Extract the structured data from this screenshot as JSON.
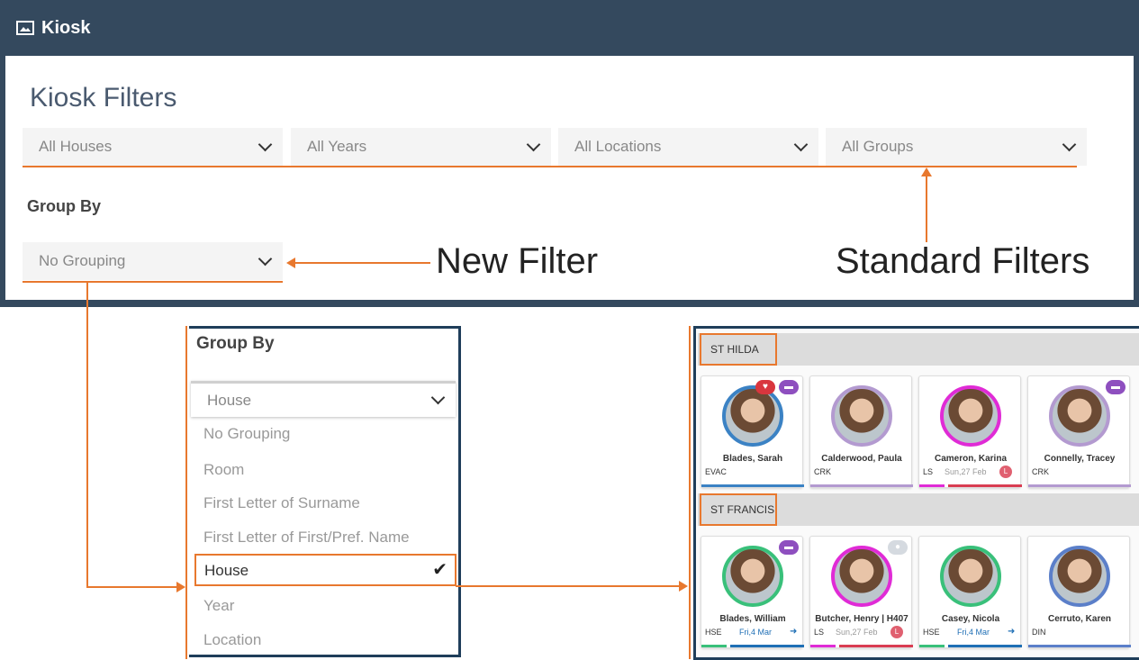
{
  "header": {
    "icon": "image-icon",
    "title": "Kiosk"
  },
  "filters": {
    "title": "Kiosk Filters",
    "houses": "All Houses",
    "years": "All Years",
    "locations": "All Locations",
    "groups": "All Groups",
    "group_by_label": "Group By",
    "group_by_value": "No Grouping"
  },
  "annotations": {
    "new_filter": "New Filter",
    "standard_filters": "Standard Filters"
  },
  "group_by_dropdown": {
    "title": "Group By",
    "selected": "House",
    "options": [
      "No Grouping",
      "Room",
      "First Letter of Surname",
      "First Letter of First/Pref. Name",
      "House",
      "Year",
      "Location"
    ]
  },
  "houses": [
    {
      "name": "ST HILDA",
      "students": [
        {
          "name": "Blades, Sarah",
          "code": "EVAC",
          "date": "",
          "ring": "#3b82c4",
          "badges": [
            "heart-icon",
            "car-icon"
          ],
          "stripes": [
            "#3b82c4"
          ]
        },
        {
          "name": "Calderwood, Paula",
          "code": "CRK",
          "date": "",
          "ring": "#b39ad0",
          "badges": [],
          "stripes": [
            "#b39ad0"
          ]
        },
        {
          "name": "Cameron, Karina",
          "code": "LS",
          "date": "Sun,27 Feb",
          "late": "L",
          "ring": "#e02bd6",
          "badges": [],
          "stripes": [
            "#e02bd6",
            "#d93d52"
          ]
        },
        {
          "name": "Connelly, Tracey",
          "code": "CRK",
          "date": "",
          "ring": "#b39ad0",
          "badges": [
            "car-icon"
          ],
          "stripes": [
            "#b39ad0"
          ]
        }
      ]
    },
    {
      "name": "ST FRANCIS",
      "students": [
        {
          "name": "Blades, William",
          "code": "HSE",
          "date": "Fri,4 Mar",
          "ring": "#39c07a",
          "badges": [
            "car-icon"
          ],
          "stripes": [
            "#39c07a",
            "#1f6fb5"
          ]
        },
        {
          "name": "Butcher, Henry | H407",
          "code": "LS",
          "date": "Sun,27 Feb",
          "late": "L",
          "ring": "#e02bd6",
          "badges": [
            "person-icon"
          ],
          "stripes": [
            "#e02bd6",
            "#d93d52"
          ]
        },
        {
          "name": "Casey, Nicola",
          "code": "HSE",
          "date": "Fri,4 Mar",
          "ring": "#39c07a",
          "badges": [],
          "stripes": [
            "#39c07a",
            "#1f6fb5"
          ]
        },
        {
          "name": "Cerruto, Karen",
          "code": "DIN",
          "date": "",
          "ring": "#5b7fc9",
          "badges": [],
          "stripes": [
            "#5b7fc9"
          ]
        }
      ]
    }
  ]
}
